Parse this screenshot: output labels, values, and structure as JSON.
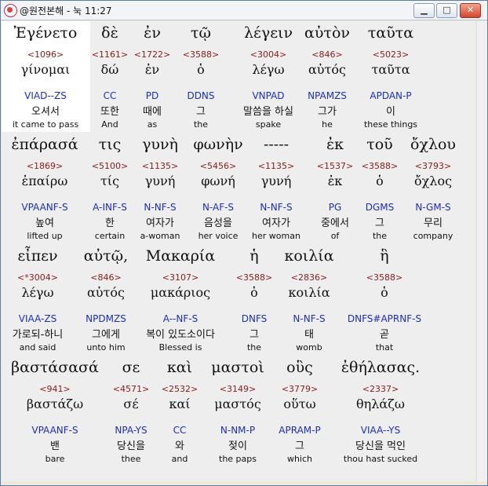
{
  "window": {
    "title": "@원전본해 - 눅 11:27",
    "buttons": {
      "minimize": "▁",
      "maximize": "□",
      "close": "✕"
    }
  },
  "rows": [
    {
      "words": [
        {
          "greek": "Ἐγένετο",
          "num": "<1096>",
          "lemma": "γίνομαι",
          "parse": "VIAD--ZS",
          "korean": "오셔서",
          "english": "it came to pass"
        },
        {
          "greek": "δὲ",
          "num": "<1161>",
          "lemma": "δώ",
          "parse": "CC",
          "korean": "또한",
          "english": "And"
        },
        {
          "greek": "ἐν",
          "num": "<1722>",
          "lemma": "ἐν",
          "parse": "PD",
          "korean": "때에",
          "english": "as"
        },
        {
          "greek": "τῷ",
          "num": "<3588>",
          "lemma": "ὁ",
          "parse": "DDNS",
          "korean": "그",
          "english": "the"
        },
        {
          "greek": "λέγειν",
          "num": "<3004>",
          "lemma": "λέγω",
          "parse": "VNPAD",
          "korean": "말씀을 하실",
          "english": "spake"
        },
        {
          "greek": "αὐτὸν",
          "num": "<846>",
          "lemma": "αὐτός",
          "parse": "NPAMZS",
          "korean": "그가",
          "english": "he"
        },
        {
          "greek": "ταῦτα",
          "num": "<5023>",
          "lemma": "ταῦτα",
          "parse": "APDAN-P",
          "korean": "이",
          "english": "these things"
        }
      ]
    },
    {
      "words": [
        {
          "greek": "ἐπάρασά",
          "num": "<1869>",
          "lemma": "ἐπαίρω",
          "parse": "VPAANF-S",
          "korean": "높여",
          "english": "lifted up"
        },
        {
          "greek": "τις",
          "num": "<5100>",
          "lemma": "τίς",
          "parse": "A-INF-S",
          "korean": "한",
          "english": "certain"
        },
        {
          "greek": "γυνὴ",
          "num": "<1135>",
          "lemma": "γυνή",
          "parse": "N-NF-S",
          "korean": "여자가",
          "english": "a-woman"
        },
        {
          "greek": "φωνὴν",
          "num": "<5456>",
          "lemma": "φωνή",
          "parse": "N-AF-S",
          "korean": "음성을",
          "english": "her voice"
        },
        {
          "greek": "-----",
          "num": "<1135>",
          "lemma": "γυνή",
          "parse": "N-NF-S",
          "korean": "여자가",
          "english": "her woman"
        },
        {
          "greek": "ἐκ",
          "num": "<1537>",
          "lemma": "ἐκ",
          "parse": "PG",
          "korean": "중에서",
          "english": "of"
        },
        {
          "greek": "τοῦ",
          "num": "<3588>",
          "lemma": "ὁ",
          "parse": "DGMS",
          "korean": "그",
          "english": "the"
        },
        {
          "greek": "ὄχλου",
          "num": "<3793>",
          "lemma": "ὄχλος",
          "parse": "N-GM-S",
          "korean": "무리",
          "english": "company"
        }
      ]
    },
    {
      "words": [
        {
          "greek": "εἶπεν",
          "num": "<*3004>",
          "lemma": "λέγω",
          "parse": "VIAA-ZS",
          "korean": "가로되-하니",
          "english": "and said"
        },
        {
          "greek": "αὐτῷ,",
          "num": "<846>",
          "lemma": "αὐτός",
          "parse": "NPDMZS",
          "korean": "그에게",
          "english": "unto him"
        },
        {
          "greek": "Μακαρία",
          "num": "<3107>",
          "lemma": "μακάριος",
          "parse": "A--NF-S",
          "korean": "복이 있도소이다",
          "english": "Blessed is"
        },
        {
          "greek": "ἡ",
          "num": "<3588>",
          "lemma": "ὁ",
          "parse": "DNFS",
          "korean": "그",
          "english": "the"
        },
        {
          "greek": "κοιλία",
          "num": "<2836>",
          "lemma": "κοιλία",
          "parse": "N-NF-S",
          "korean": "태",
          "english": "womb"
        },
        {
          "greek": "ἣ",
          "num": "<3588>",
          "lemma": "ὁ",
          "parse": "DNFS#APRNF-S",
          "korean": "곧",
          "english": "that"
        }
      ]
    },
    {
      "words": [
        {
          "greek": "βαστάσασά",
          "num": "<941>",
          "lemma": "βαστάζω",
          "parse": "VPAANF-S",
          "korean": "밴",
          "english": "bare"
        },
        {
          "greek": "σε",
          "num": "<4571>",
          "lemma": "σέ",
          "parse": "NPA-YS",
          "korean": "당신을",
          "english": "thee"
        },
        {
          "greek": "καὶ",
          "num": "<2532>",
          "lemma": "καί",
          "parse": "CC",
          "korean": "와",
          "english": "and"
        },
        {
          "greek": "μαστοὶ",
          "num": "<3149>",
          "lemma": "μαστός",
          "parse": "N-NM-P",
          "korean": "젖이",
          "english": "the paps"
        },
        {
          "greek": "οὓς",
          "num": "<3779>",
          "lemma": "οὕτω",
          "parse": "APRAM-P",
          "korean": "그",
          "english": "which"
        },
        {
          "greek": "ἐθήλασας.",
          "num": "<2337>",
          "lemma": "θηλάζω",
          "parse": "VIAA--YS",
          "korean": "당신을 먹인",
          "english": "thou hast sucked"
        }
      ]
    }
  ]
}
